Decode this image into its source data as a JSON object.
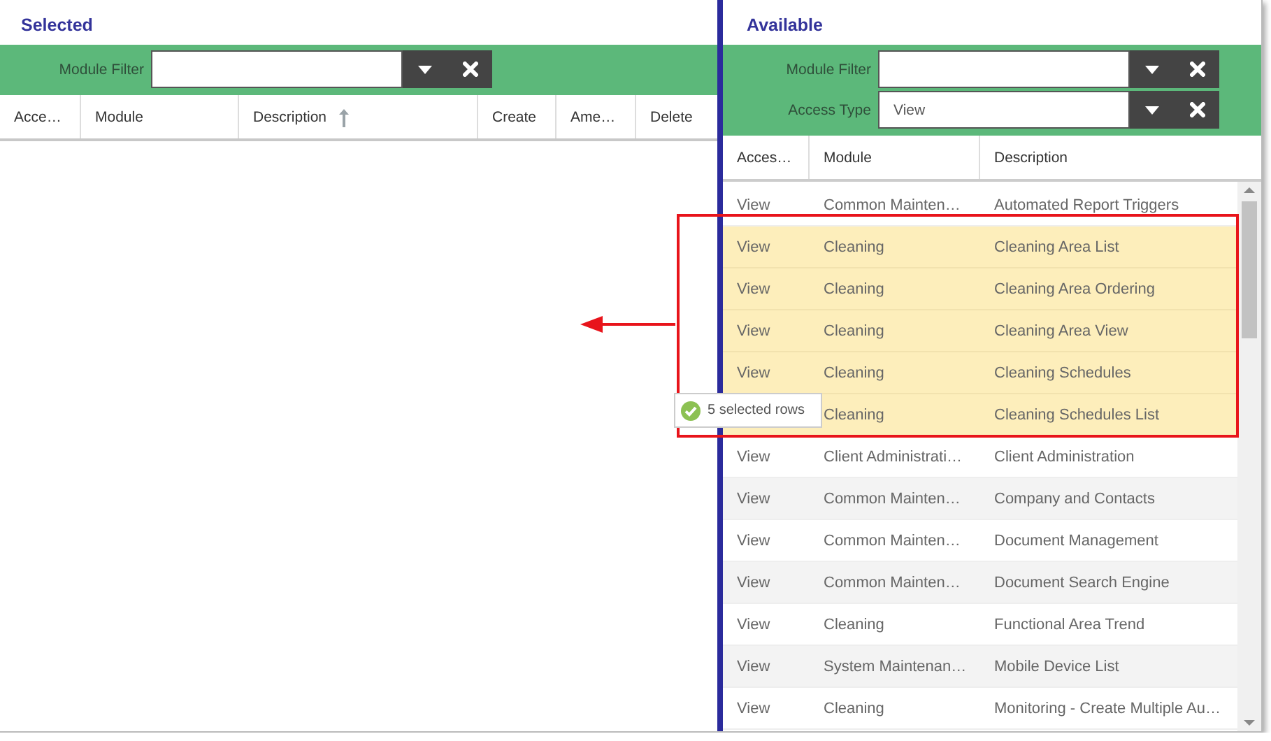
{
  "selected_panel": {
    "title": "Selected",
    "filters": [
      {
        "label": "Module Filter"
      }
    ],
    "columns": [
      {
        "label": "Acce…"
      },
      {
        "label": "Module"
      },
      {
        "label": "Description",
        "sorted_ascending": true
      },
      {
        "label": "Create"
      },
      {
        "label": "Ame…"
      },
      {
        "label": "Delete"
      }
    ]
  },
  "available_panel": {
    "title": "Available",
    "filters": [
      {
        "label": "Module Filter"
      },
      {
        "label": "Access Type",
        "value": "View"
      }
    ],
    "columns": [
      {
        "label": "Acces…"
      },
      {
        "label": "Module"
      },
      {
        "label": "Description"
      }
    ],
    "rows": [
      {
        "access": "View",
        "module": "Common Mainten…",
        "description": "Automated Report Triggers",
        "selected": false
      },
      {
        "access": "View",
        "module": "Cleaning",
        "description": "Cleaning Area List",
        "selected": true
      },
      {
        "access": "View",
        "module": "Cleaning",
        "description": "Cleaning Area Ordering",
        "selected": true
      },
      {
        "access": "View",
        "module": "Cleaning",
        "description": "Cleaning Area View",
        "selected": true
      },
      {
        "access": "View",
        "module": "Cleaning",
        "description": "Cleaning Schedules",
        "selected": true
      },
      {
        "module": "Cleaning",
        "description": "Cleaning Schedules List",
        "selected": true
      },
      {
        "access": "View",
        "module": "Client Administrati…",
        "description": "Client Administration",
        "selected": false
      },
      {
        "access": "View",
        "module": "Common Mainten…",
        "description": "Company and Contacts",
        "selected": false
      },
      {
        "access": "View",
        "module": "Common Mainten…",
        "description": "Document Management",
        "selected": false
      },
      {
        "access": "View",
        "module": "Common Mainten…",
        "description": "Document Search Engine",
        "selected": false
      },
      {
        "access": "View",
        "module": "Cleaning",
        "description": "Functional Area Trend",
        "selected": false
      },
      {
        "access": "View",
        "module": "System Maintenan…",
        "description": "Mobile Device List",
        "selected": false
      },
      {
        "access": "View",
        "module": "Cleaning",
        "description": "Monitoring - Create Multiple Au…",
        "selected": false
      }
    ]
  },
  "drag_tooltip": {
    "text": "5 selected rows"
  }
}
